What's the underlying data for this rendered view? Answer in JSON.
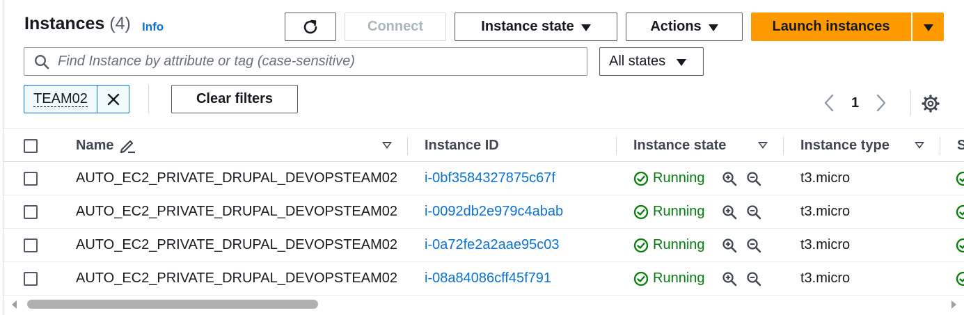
{
  "header": {
    "title": "Instances",
    "count": "(4)",
    "info": "Info",
    "connect_label": "Connect",
    "instance_state_label": "Instance state",
    "actions_label": "Actions",
    "launch_label": "Launch instances"
  },
  "filters": {
    "search_placeholder": "Find Instance by attribute or tag (case-sensitive)",
    "states_label": "All states",
    "token_label": "TEAM02",
    "clear_label": "Clear filters"
  },
  "pagination": {
    "page": "1"
  },
  "table": {
    "columns": [
      "Name",
      "Instance ID",
      "Instance state",
      "Instance type",
      "S"
    ],
    "rows": [
      {
        "name": "AUTO_EC2_PRIVATE_DRUPAL_DEVOPSTEAM02",
        "id": "i-0bf3584327875c67f",
        "state": "Running",
        "type": "t3.micro"
      },
      {
        "name": "AUTO_EC2_PRIVATE_DRUPAL_DEVOPSTEAM02",
        "id": "i-0092db2e979c4abab",
        "state": "Running",
        "type": "t3.micro"
      },
      {
        "name": "AUTO_EC2_PRIVATE_DRUPAL_DEVOPSTEAM02",
        "id": "i-0a72fe2a2aae95c03",
        "state": "Running",
        "type": "t3.micro"
      },
      {
        "name": "AUTO_EC2_PRIVATE_DRUPAL_DEVOPSTEAM02",
        "id": "i-08a84086cff45f791",
        "state": "Running",
        "type": "t3.micro"
      }
    ]
  },
  "icons": {
    "refresh": "refresh-icon",
    "search": "search-icon",
    "close": "close-icon",
    "settings": "gear-icon",
    "edit": "pencil-icon",
    "status": "check-circle-icon",
    "zoom_in": "zoom-in-icon",
    "zoom_out": "zoom-out-icon"
  },
  "colors": {
    "primary": "#ff9900",
    "link": "#0972d3",
    "success": "#037f0c",
    "border": "#545b64"
  }
}
